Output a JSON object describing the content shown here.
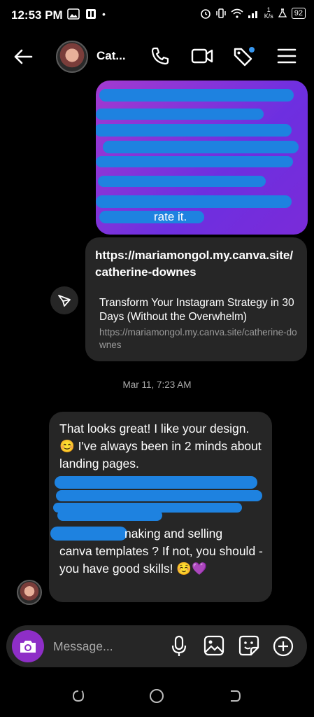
{
  "status_bar": {
    "time": "12:53 PM",
    "net_speed_value": "1",
    "net_speed_unit": "K/s",
    "battery": "92"
  },
  "header": {
    "contact_name": "Cat...",
    "icons": [
      "back-arrow-icon",
      "phone-icon",
      "video-icon",
      "tag-icon",
      "menu-icon"
    ]
  },
  "messages": {
    "sent_bubble_visible_text": "rate it.",
    "link_card": {
      "url": "https://mariamongol.my.canva.site/catherine-downes",
      "title": "Transform Your Instagram Strategy in 30 Days (Without the Overwhelm)",
      "subtitle": "https://mariamongol.my.canva.site/catherine-downes"
    },
    "timestamp": "Mar 11, 7:23 AM",
    "received_text_top": "That looks great! I like your design. 😊 I've always been in 2 minds about landing pages.",
    "received_text_bottom_line1": "naking and selling",
    "received_text_bottom_rest": "canva templates ? If not, you should - you have good skills! ☺️💜"
  },
  "composer": {
    "placeholder": "Message..."
  },
  "colors": {
    "accent_purple": "#8e2ec7",
    "redaction_blue": "#1e82e0",
    "bubble_gray": "#262626"
  }
}
